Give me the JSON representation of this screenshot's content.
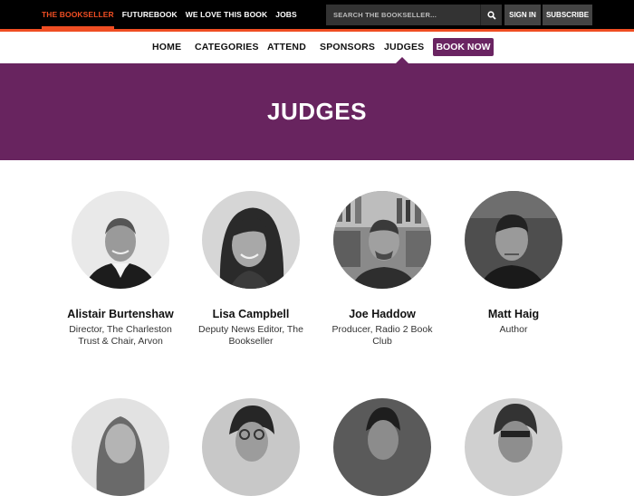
{
  "topnav": {
    "items": [
      "THE BOOKSELLER",
      "FUTUREBOOK",
      "WE LOVE THIS BOOK",
      "JOBS"
    ],
    "search_placeholder": "SEARCH THE BOOKSELLER...",
    "sign_in": "SIGN IN",
    "subscribe": "SUBSCRIBE"
  },
  "mainnav": {
    "items": [
      "HOME",
      "CATEGORIES",
      "ATTEND",
      "SPONSORS",
      "JUDGES"
    ],
    "book_now": "BOOK NOW"
  },
  "hero": {
    "title": "JUDGES"
  },
  "judges": [
    {
      "name": "Alistair Burtenshaw",
      "role": "Director, The Charleston Trust & Chair, Arvon"
    },
    {
      "name": "Lisa Campbell",
      "role": "Deputy News Editor, The Bookseller"
    },
    {
      "name": "Joe Haddow",
      "role": "Producer, Radio 2 Book Club"
    },
    {
      "name": "Matt Haig",
      "role": "Author"
    }
  ],
  "colors": {
    "accent": "#f04e23",
    "brand_purple": "#68245f",
    "button_purple": "#6a2462"
  }
}
